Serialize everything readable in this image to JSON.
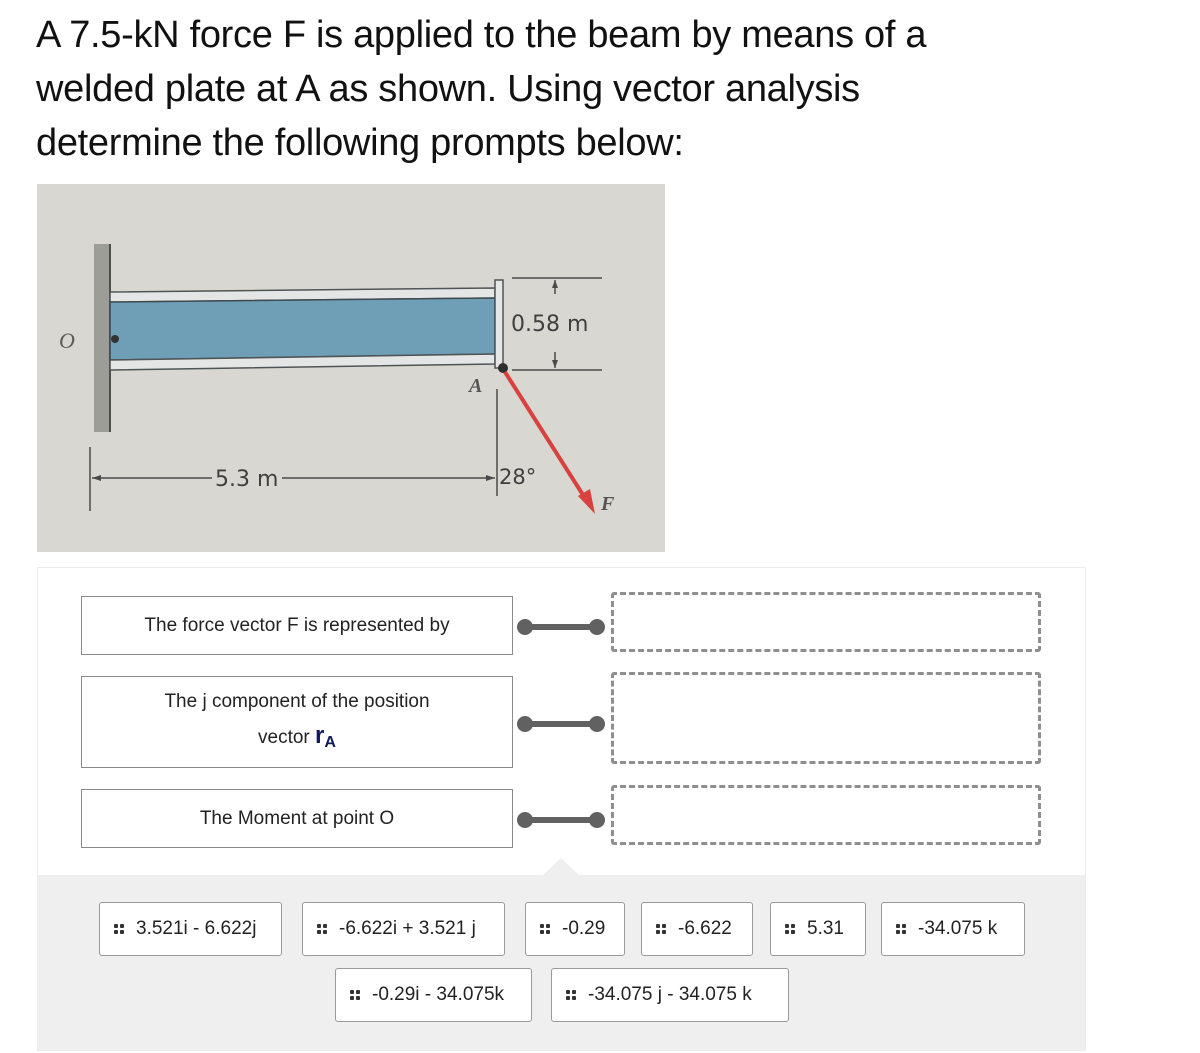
{
  "question": {
    "text": "A 7.5-kN force F is applied to the beam by means of a welded plate at A as shown. Using vector analysis determine the following prompts below:"
  },
  "figure": {
    "origin_label": "O",
    "point_label": "A",
    "force_label": "F",
    "height_dim": "0.58 m",
    "length_dim": "5.3 m",
    "angle_label": "28°",
    "force_color": "#d9413e",
    "beam_color": "#6f9fb6"
  },
  "matching": {
    "prompts": [
      {
        "label": "The force vector F is represented by"
      },
      {
        "label_pre": "The j component of the position",
        "label_mid": "vector",
        "symbol": "r",
        "subscript": "A"
      },
      {
        "label": "The Moment at point O"
      }
    ],
    "answers_pool": [
      "3.521i - 6.622j",
      "-6.622i + 3.521 j",
      "-0.29",
      "-6.622",
      "5.31",
      "-34.075 k",
      "-0.29i - 34.075k",
      "-34.075 j - 34.075 k"
    ]
  }
}
